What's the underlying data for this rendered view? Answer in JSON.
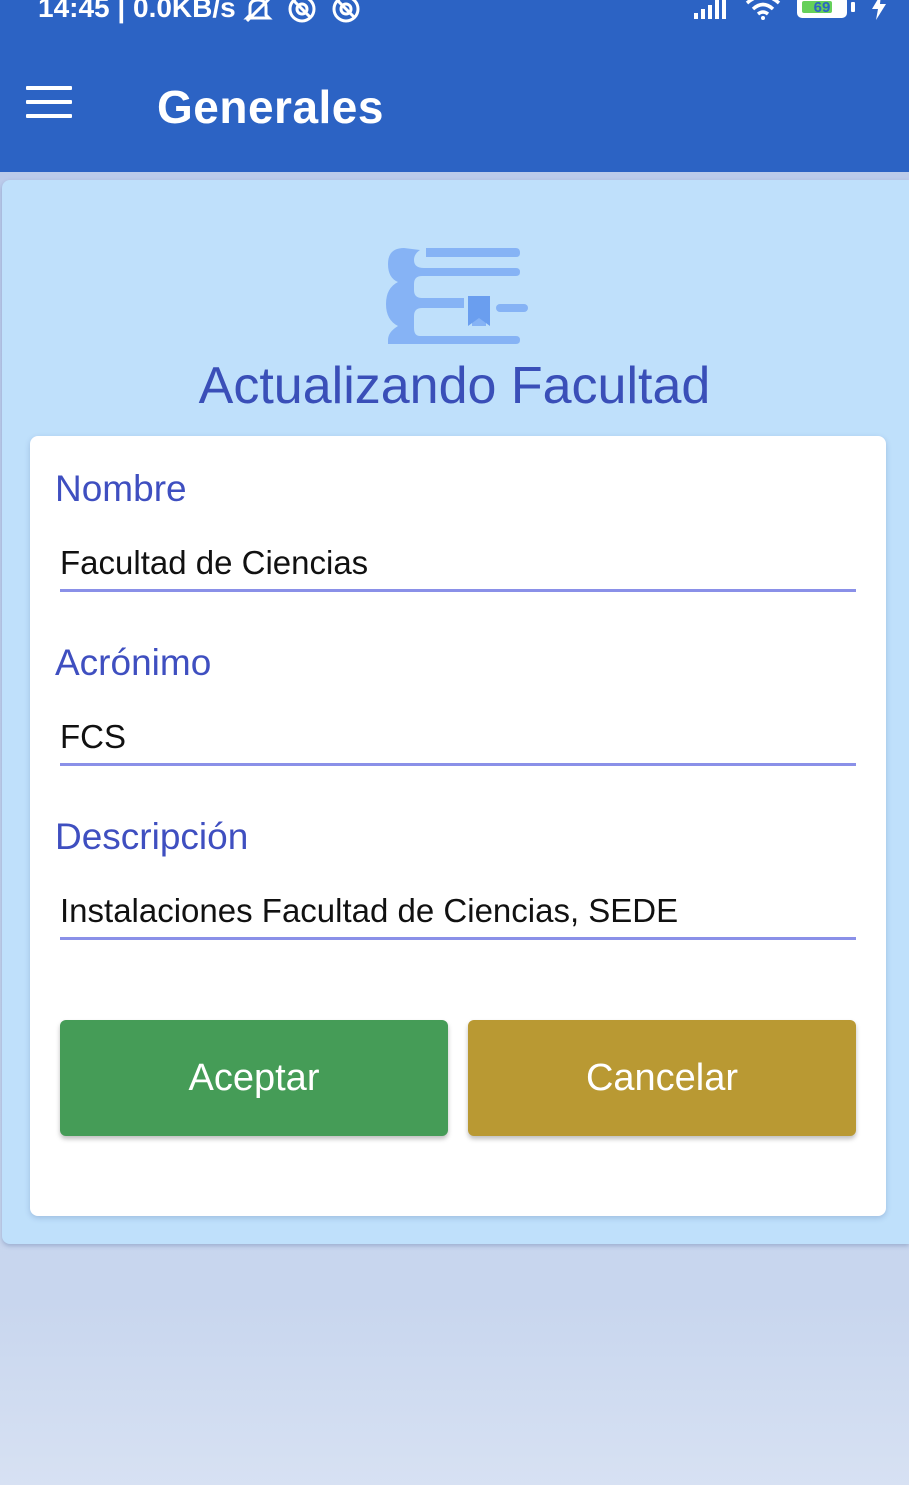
{
  "status_bar": {
    "time_speed": "14:45 | 0.0KB/s",
    "battery": "69"
  },
  "app_bar": {
    "title": "Generales"
  },
  "page": {
    "heading": "Actualizando Facultad"
  },
  "form": {
    "nombre_label": "Nombre",
    "nombre_value": "Facultad de Ciencias",
    "acronimo_label": "Acrónimo",
    "acronimo_value": "FCS",
    "descripcion_label": "Descripción",
    "descripcion_value": "Instalaciones Facultad de Ciencias, SEDE",
    "accept_label": "Aceptar",
    "cancel_label": "Cancelar"
  },
  "colors": {
    "app_bar": "#2c63c4",
    "panel": "#bfe0fb",
    "heading": "#3a4fb8",
    "accept_button": "#459c57",
    "cancel_button": "#b99933"
  },
  "icons": [
    "menu-icon",
    "mute-icon",
    "sync-icon",
    "signal-icon",
    "wifi-icon",
    "charging-icon",
    "faculty-book-icon"
  ]
}
